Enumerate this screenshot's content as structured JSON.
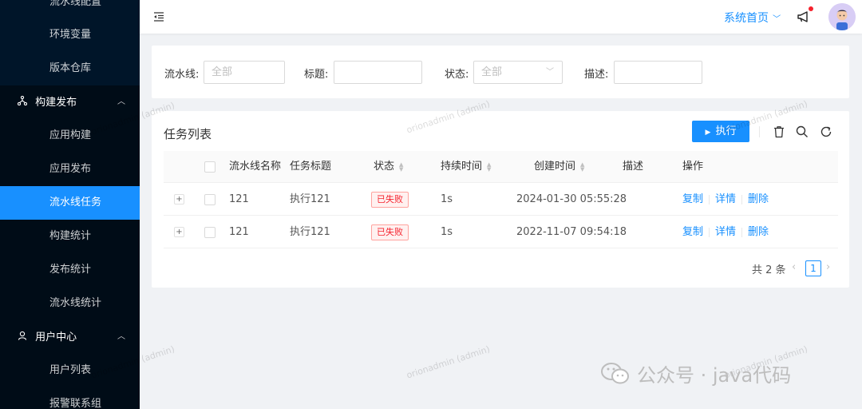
{
  "sidebar": {
    "items_top": [
      {
        "label": "流水线配置"
      },
      {
        "label": "环境变量"
      },
      {
        "label": "版本仓库"
      }
    ],
    "group_build": {
      "label": "构建发布"
    },
    "build_items": [
      {
        "label": "应用构建"
      },
      {
        "label": "应用发布"
      },
      {
        "label": "流水线任务"
      },
      {
        "label": "构建统计"
      },
      {
        "label": "发布统计"
      },
      {
        "label": "流水线统计"
      }
    ],
    "group_user": {
      "label": "用户中心"
    },
    "user_items": [
      {
        "label": "用户列表"
      },
      {
        "label": "报警联系组"
      }
    ]
  },
  "header": {
    "home_label": "系统首页",
    "accent": "#1890ff"
  },
  "filter": {
    "pipeline_label": "流水线:",
    "pipeline_placeholder": "全部",
    "title_label": "标题:",
    "status_label": "状态:",
    "status_value": "全部",
    "desc_label": "描述:"
  },
  "table": {
    "title": "任务列表",
    "exec_label": "执行",
    "columns": {
      "pipeline_name": "流水线名称",
      "task_title": "任务标题",
      "status": "状态",
      "duration": "持续时间",
      "created": "创建时间",
      "desc": "描述",
      "ops": "操作"
    },
    "rows": [
      {
        "expand": "+",
        "pipeline": "121",
        "title": "执行121",
        "status": "已失败",
        "duration": "1s",
        "created": "2024-01-30 05:55:28",
        "desc": "",
        "op_copy": "复制",
        "op_detail": "详情",
        "op_delete": "删除"
      },
      {
        "expand": "+",
        "pipeline": "121",
        "title": "执行121",
        "status": "已失败",
        "duration": "1s",
        "created": "2022-11-07 09:54:18",
        "desc": "",
        "op_copy": "复制",
        "op_detail": "详情",
        "op_delete": "删除"
      }
    ],
    "pager": {
      "total": "共 2 条",
      "current": "1",
      "prev": "‹",
      "next": "›"
    }
  },
  "watermark": "orionadmin (admin)",
  "brand": "公众号 · java代码"
}
